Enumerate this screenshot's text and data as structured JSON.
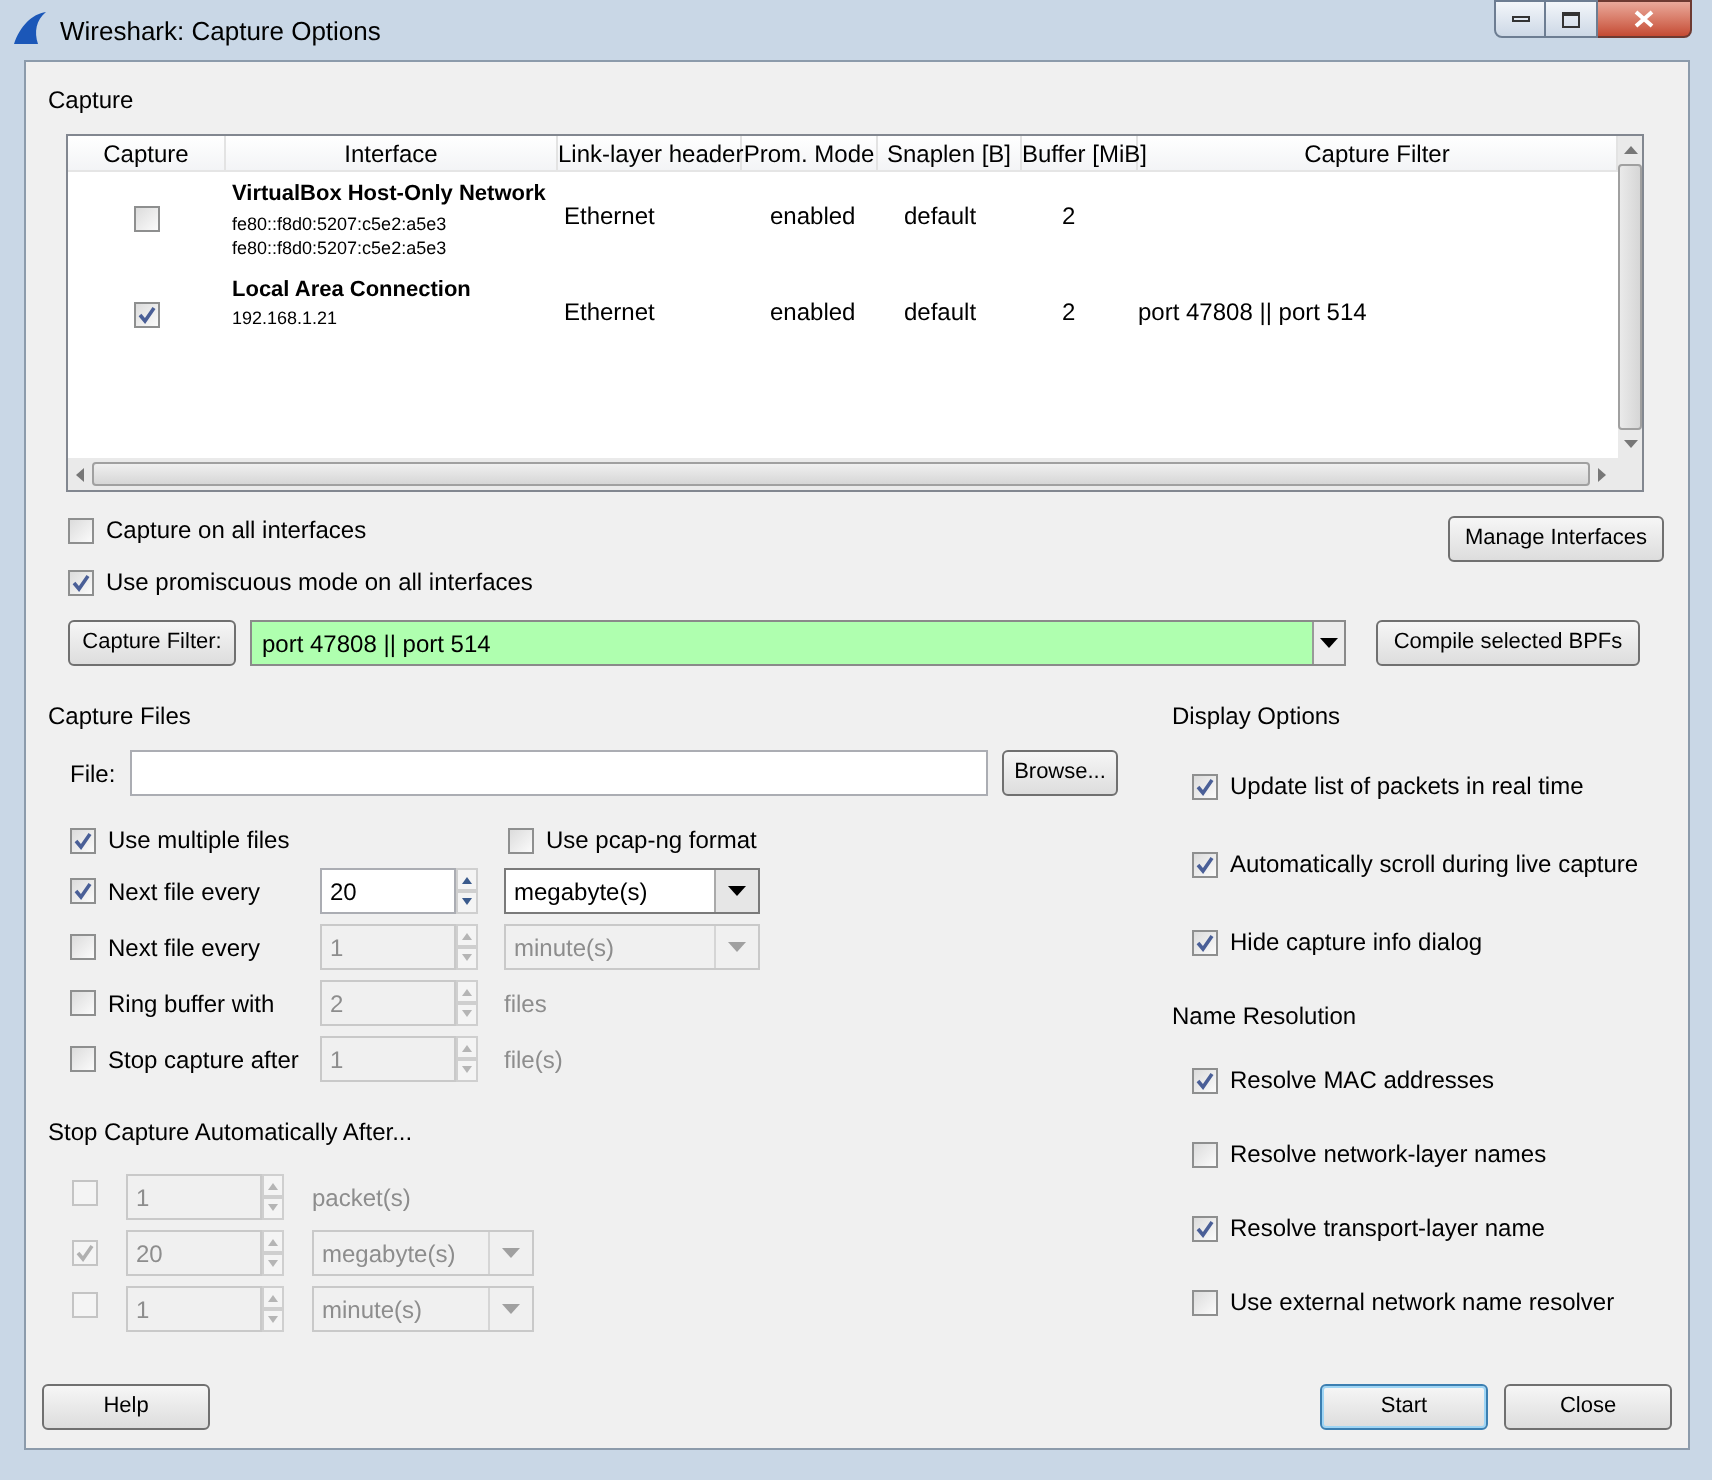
{
  "window": {
    "title": "Wireshark: Capture Options"
  },
  "capture": {
    "title": "Capture",
    "table": {
      "columns": [
        "Capture",
        "Interface",
        "Link-layer header",
        "Prom. Mode",
        "Snaplen [B]",
        "Buffer [MiB]",
        "Capture Filter"
      ],
      "rows": [
        {
          "checked": false,
          "name": "VirtualBox Host-Only Network",
          "addresses": [
            "fe80::f8d0:5207:c5e2:a5e3",
            "fe80::f8d0:5207:c5e2:a5e3"
          ],
          "link_layer": "Ethernet",
          "prom_mode": "enabled",
          "snaplen": "default",
          "buffer": "2"
        },
        {
          "checked": true,
          "name": "Local Area Connection",
          "addresses": [
            "192.168.1.21"
          ],
          "link_layer": "Ethernet",
          "prom_mode": "enabled",
          "snaplen": "default",
          "buffer": "2",
          "capture_filter": "port 47808 || port 514"
        }
      ]
    },
    "options": [
      {
        "label": "Capture on all interfaces",
        "checked": false
      },
      {
        "label": "Use promiscuous mode on all interfaces",
        "checked": true
      }
    ],
    "manage_button": "Manage Interfaces",
    "filter_button": "Capture Filter:",
    "filter_value": "port 47808 || port 514",
    "compile_button": "Compile selected BPFs"
  },
  "capture_files": {
    "title": "Capture Files",
    "file_label": "File:",
    "browse_button": "Browse...",
    "multiple_files": {
      "label": "Use multiple files",
      "checked": true
    },
    "pcapng": {
      "label": "Use pcap-ng format",
      "checked": false
    },
    "rows": [
      {
        "label": "Next file every",
        "checked": true,
        "value": "20",
        "unit": "megabyte(s)",
        "kind": "combo"
      },
      {
        "label": "Next file every",
        "checked": false,
        "value": "1",
        "unit": "minute(s)",
        "kind": "combo"
      },
      {
        "label": "Ring buffer with",
        "checked": false,
        "value": "2",
        "unit": "files",
        "kind": "text"
      },
      {
        "label": "Stop capture after",
        "checked": false,
        "value": "1",
        "unit": "file(s)",
        "kind": "text"
      }
    ]
  },
  "stop_capture": {
    "title": "Stop Capture Automatically After...",
    "rows": [
      {
        "checked": false,
        "value": "1",
        "unit": "packet(s)",
        "kind": "text"
      },
      {
        "checked": true,
        "value": "20",
        "unit": "megabyte(s)",
        "kind": "combo"
      },
      {
        "checked": false,
        "value": "1",
        "unit": "minute(s)",
        "kind": "combo"
      }
    ]
  },
  "display_options": {
    "title": "Display Options",
    "items": [
      {
        "label": "Update list of packets in real time",
        "checked": true
      },
      {
        "label": "Automatically scroll during live capture",
        "checked": true
      },
      {
        "label": "Hide capture info dialog",
        "checked": true
      }
    ]
  },
  "name_resolution": {
    "title": "Name Resolution",
    "items": [
      {
        "label": "Resolve MAC addresses",
        "checked": true
      },
      {
        "label": "Resolve network-layer names",
        "checked": false
      },
      {
        "label": "Resolve transport-layer name",
        "checked": true
      },
      {
        "label": "Use external network name resolver",
        "checked": false
      }
    ]
  },
  "buttons": [
    {
      "label": "Help",
      "default": false
    },
    {
      "label": "Start",
      "default": true
    },
    {
      "label": "Close",
      "default": false
    }
  ]
}
